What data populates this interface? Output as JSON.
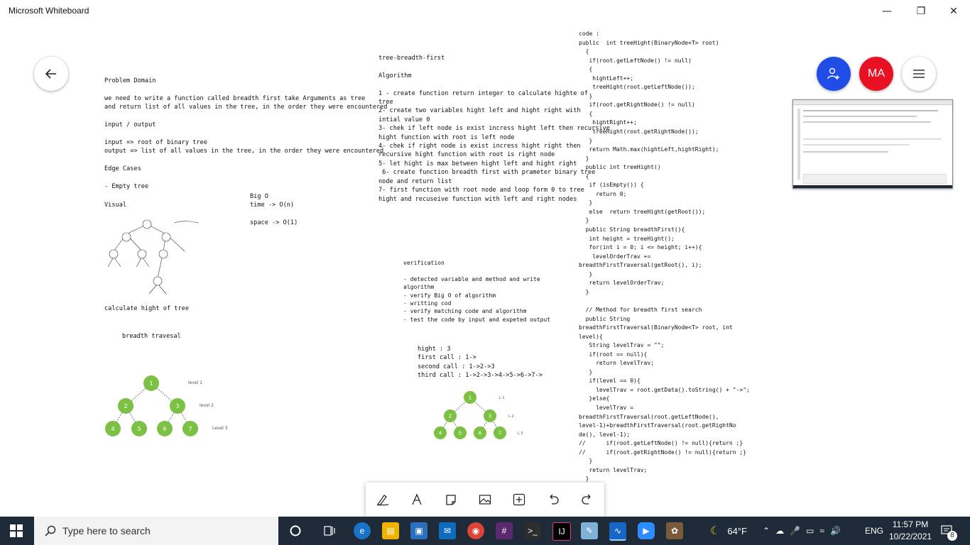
{
  "window": {
    "title": "Microsoft Whiteboard"
  },
  "header": {
    "avatar_initials": "MA"
  },
  "notes": {
    "problem": [
      "Problem Domain",
      "",
      "we need to write a function called breadth first take Arguments as tree",
      "and return list of all values in the tree, in the order they were encountered",
      "",
      "input / output",
      "",
      "input => root of binary tree",
      "output => list of all values in the tree, in the order they were encountered",
      "",
      "Edge Cases",
      "",
      "- Empty tree"
    ],
    "visual_label": "Visual",
    "bigo": [
      "Big O",
      "time -> O(n)",
      "",
      "space -> O(1)"
    ],
    "calc_height": "calculate hight of tree",
    "breadth_traversal": "breadth travesal",
    "algorithm": [
      "tree-breadth-first",
      "",
      "Algorithm",
      "",
      "1 - create function return integer to calculate highte of",
      "tree",
      "2- create two variables hight left and hight right with",
      "intial value 0",
      "3- chek if left node is exist incress hight left then recursive",
      "hight function with root is left node",
      "4- chek if right node is exist incress hight right then",
      "recursive hight function with root is right node",
      "5- let hight is max between hight left and hight right",
      " 6- create function breadth first with prameter binary tree",
      "node and return list",
      "7- first function with root node and loop form 0 to tree",
      "hight and recuseive function with left and right nodes"
    ],
    "verification": [
      "verification",
      "",
      "- detected variable and method and write",
      "algorithm",
      "- verify Big O of algorithm",
      "- writting cod",
      "- verify matching code and algorithm",
      "- test the code by input and expeted output"
    ],
    "calls": [
      "hight : 3",
      "first call : 1->",
      "second call : 1->2->3",
      "third call : 1->2->3->4->5->6->7->"
    ],
    "code": [
      "code :",
      "public  int treeHight(BinaryNode<T> root)",
      "  {",
      "   if(root.getLeftNode() != null)",
      "   {",
      "    hightLeft++;",
      "    treeHight(root.getLeftNode());",
      "   }",
      "   if(root.getRightNode() != null)",
      "   {",
      "    hightRight++;",
      "    treeHight(root.getRightNode());",
      "   }",
      "   return Math.max(hightLeft,hightRight);",
      "  }",
      "  public int treeHight()",
      "  {",
      "   if (isEmpty()) {",
      "     return 0;",
      "   }",
      "   else  return treeHight(getRoot());",
      "  }",
      "  public String breadthFirst(){",
      "   int height = treeHight();",
      "   for(int i = 0; i <= height; i++){",
      "    levelOrderTrav +=",
      "breadthFirstTraversal(getRoot(), i);",
      "   }",
      "   return levelOrderTrav;",
      "  }",
      "",
      "  // Method for breadth first search",
      "  public String",
      "breadthFirstTraversal(BinaryNode<T> root, int",
      "level){",
      "   String levelTrav = \"\";",
      "   if(root == null){",
      "     return levelTrav;",
      "   }",
      "   if(level == 0){",
      "     levelTrav = root.getData().toString() + \"->\";",
      "   }else{",
      "     levelTrav =",
      "breadthFirstTraversal(root.getLeftNode(),",
      "level-1)+breadthFirstTraversal(root.getRightNo",
      "de(), level-1);",
      "//      if(root.getLeftNode() != null){return ;}",
      "//      if(root.getRightNode() != null){return ;}",
      "   }",
      "   return levelTrav;",
      "  }"
    ]
  },
  "tree_large": {
    "nodes": [
      "1",
      "2",
      "3",
      "4",
      "5",
      "6",
      "7"
    ],
    "level_labels": [
      "level 1",
      "level 2",
      "Level 3"
    ]
  },
  "tree_small": {
    "nodes": [
      "1",
      "2",
      "3",
      "4",
      "5",
      "6",
      "7"
    ],
    "level_labels": [
      "L 1",
      "L 2",
      "L 3"
    ]
  },
  "taskbar": {
    "search_placeholder": "Type here to search",
    "temperature": "64°F",
    "language": "ENG",
    "time": "11:57 PM",
    "date": "10/22/2021",
    "notification_count": "8"
  },
  "colors": {
    "node_green": "#7cc144",
    "add_person_blue": "#1f4de6",
    "avatar_red": "#e81123",
    "taskbar": "#1f2a38"
  }
}
